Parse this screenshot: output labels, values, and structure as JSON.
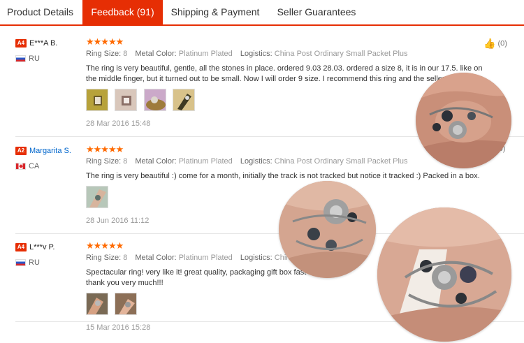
{
  "tabs": [
    "Product Details",
    "Feedback (91)",
    "Shipping & Payment",
    "Seller Guarantees"
  ],
  "meta_keys": {
    "ring_size": "Ring Size:",
    "metal_color": "Metal Color:",
    "logistics": "Logistics:"
  },
  "likes": {
    "r1": "(0)",
    "r2": "(0)"
  },
  "reviews": [
    {
      "badge": "A4",
      "name": "E***A B.",
      "country": "RU",
      "rating": 5,
      "stars": "★★★★★",
      "ring_size": "8",
      "metal_color": "Platinum Plated",
      "logistics": "China Post Ordinary Small Packet Plus",
      "text": "The ring is very beautiful, gentle, all the stones in place. ordered 9.03 28.03. ordered a size 8, it is in our 17.5. like on the middle finger, but it turned out to be small. Now I will order 9 size. I recommend this ring and the seller.",
      "date": "28 Mar 2016 15:48"
    },
    {
      "badge": "A2",
      "name": "Margarita S.",
      "country": "CA",
      "rating": 5,
      "stars": "★★★★★",
      "ring_size": "8",
      "metal_color": "Platinum Plated",
      "logistics": "China Post Ordinary Small Packet Plus",
      "text": "The ring is very beautiful :) come for a month, initially the track is not tracked but notice it tracked :) Packed in a box.",
      "date": "28 Jun 2016 11:12"
    },
    {
      "badge": "A4",
      "name": "L***v P.",
      "country": "RU",
      "rating": 5,
      "stars": "★★★★★",
      "ring_size": "8",
      "metal_color": "Platinum Plated",
      "logistics": "China",
      "text": "Spectacular ring! very like it! great quality, packaging gift box fast",
      "text_line2": "thank you very much!!!",
      "date": "15 Mar 2016 15:28"
    }
  ],
  "colors": {
    "accent": "#e62e04",
    "star": "#ff6a00",
    "link": "#0066cc"
  }
}
